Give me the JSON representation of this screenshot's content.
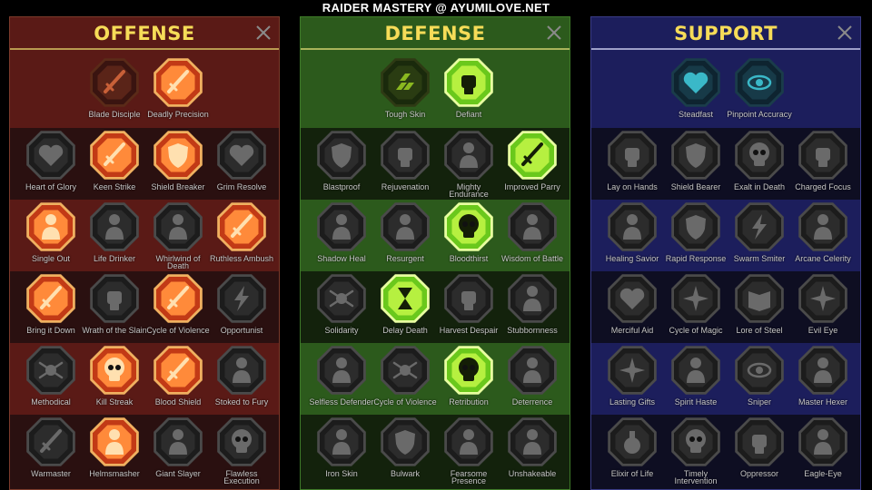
{
  "site": {
    "title": "RAIDER MASTERY @ AYUMILOVE.NET"
  },
  "panels": [
    {
      "key": "offense",
      "title": "OFFENSE",
      "colors": {
        "band_dark": "#2a1010",
        "band_light": "#5a1a16",
        "border": "#7a3a2a",
        "line": "#b89a50"
      },
      "tier1": [
        {
          "label": "Blade Disciple",
          "active": false,
          "icon": "crossed-swords-icon"
        },
        {
          "label": "Deadly Precision",
          "active": true,
          "icon": "sword-icon"
        }
      ],
      "rows": [
        [
          {
            "label": "Heart of Glory",
            "active": false,
            "icon": "horned-heart-icon"
          },
          {
            "label": "Keen Strike",
            "active": true,
            "icon": "slash-icon"
          },
          {
            "label": "Shield Breaker",
            "active": true,
            "icon": "broken-shield-icon"
          },
          {
            "label": "Grim Resolve",
            "active": false,
            "icon": "thorn-heart-icon"
          }
        ],
        [
          {
            "label": "Single Out",
            "active": true,
            "icon": "arrows-target-icon"
          },
          {
            "label": "Life Drinker",
            "active": false,
            "icon": "fanged-mouth-icon"
          },
          {
            "label": "Whirlwind of Death",
            "active": false,
            "icon": "whirlwind-icon"
          },
          {
            "label": "Ruthless Ambush",
            "active": true,
            "icon": "dagger-hand-icon"
          }
        ],
        [
          {
            "label": "Bring it Down",
            "active": true,
            "icon": "falling-sword-icon"
          },
          {
            "label": "Wrath of the Slain",
            "active": false,
            "icon": "fist-icon"
          },
          {
            "label": "Cycle of Violence",
            "active": true,
            "icon": "axe-icon"
          },
          {
            "label": "Opportunist",
            "active": false,
            "icon": "chain-lightning-icon"
          }
        ],
        [
          {
            "label": "Methodical",
            "active": false,
            "icon": "spider-icon"
          },
          {
            "label": "Kill Streak",
            "active": true,
            "icon": "skull-icon"
          },
          {
            "label": "Blood Shield",
            "active": true,
            "icon": "sword-shield-icon"
          },
          {
            "label": "Stoked to Fury",
            "active": false,
            "icon": "flexing-figure-icon"
          }
        ],
        [
          {
            "label": "Warmaster",
            "active": false,
            "icon": "falling-blade-icon"
          },
          {
            "label": "Helmsmasher",
            "active": true,
            "icon": "helmet-icon"
          },
          {
            "label": "Giant Slayer",
            "active": false,
            "icon": "giant-icon"
          },
          {
            "label": "Flawless Execution",
            "active": false,
            "icon": "skull-blade-icon"
          }
        ]
      ]
    },
    {
      "key": "defense",
      "title": "DEFENSE",
      "colors": {
        "band_dark": "#13220c",
        "band_light": "#2c5a1c",
        "border": "#3e7a28",
        "line": "#a8b45a"
      },
      "tier1": [
        {
          "label": "Tough Skin",
          "active": false,
          "icon": "scales-icon"
        },
        {
          "label": "Defiant",
          "active": true,
          "icon": "raised-fist-icon"
        }
      ],
      "rows": [
        [
          {
            "label": "Blastproof",
            "active": false,
            "icon": "shield-chevron-icon"
          },
          {
            "label": "Rejuvenation",
            "active": false,
            "icon": "healing-hand-icon"
          },
          {
            "label": "Mighty Endurance",
            "active": false,
            "icon": "muscle-torso-icon"
          },
          {
            "label": "Improved Parry",
            "active": true,
            "icon": "parry-blades-icon"
          }
        ],
        [
          {
            "label": "Shadow Heal",
            "active": false,
            "icon": "shadow-figure-icon"
          },
          {
            "label": "Resurgent",
            "active": false,
            "icon": "knight-icon"
          },
          {
            "label": "Bloodthirst",
            "active": true,
            "icon": "skull-heart-icon"
          },
          {
            "label": "Wisdom of Battle",
            "active": false,
            "icon": "hooded-head-icon"
          }
        ],
        [
          {
            "label": "Solidarity",
            "active": false,
            "icon": "crowd-icon"
          },
          {
            "label": "Delay Death",
            "active": true,
            "icon": "hourglass-icon"
          },
          {
            "label": "Harvest Despair",
            "active": false,
            "icon": "open-palm-icon"
          },
          {
            "label": "Stubbornness",
            "active": false,
            "icon": "bull-icon"
          }
        ],
        [
          {
            "label": "Selfless Defender",
            "active": false,
            "icon": "running-figure-icon"
          },
          {
            "label": "Cycle of Violence",
            "active": false,
            "icon": "drops-icon"
          },
          {
            "label": "Retribution",
            "active": true,
            "icon": "radiant-skull-icon"
          },
          {
            "label": "Deterrence",
            "active": false,
            "icon": "deflect-icon"
          }
        ],
        [
          {
            "label": "Iron Skin",
            "active": false,
            "icon": "demon-face-icon"
          },
          {
            "label": "Bulwark",
            "active": false,
            "icon": "layered-shield-icon"
          },
          {
            "label": "Fearsome Presence",
            "active": false,
            "icon": "screaming-face-icon"
          },
          {
            "label": "Unshakeable",
            "active": false,
            "icon": "strongman-icon"
          }
        ]
      ]
    },
    {
      "key": "support",
      "title": "SUPPORT",
      "colors": {
        "band_dark": "#0e0e22",
        "band_light": "#1c1e5c",
        "border": "#3a3c86",
        "line": "#9ea0c8"
      },
      "tier1": [
        {
          "label": "Steadfast",
          "active": false,
          "icon": "plus-heart-icon"
        },
        {
          "label": "Pinpoint Accuracy",
          "active": false,
          "icon": "bullseye-icon"
        }
      ],
      "rows": [
        [
          {
            "label": "Lay on Hands",
            "active": false,
            "icon": "praying-hands-icon"
          },
          {
            "label": "Shield Bearer",
            "active": false,
            "icon": "shield-icon"
          },
          {
            "label": "Exalt in Death",
            "active": false,
            "icon": "skull-smoke-icon"
          },
          {
            "label": "Charged Focus",
            "active": false,
            "icon": "bow-hand-icon"
          }
        ],
        [
          {
            "label": "Healing Savior",
            "active": false,
            "icon": "healer-figure-icon"
          },
          {
            "label": "Rapid Response",
            "active": false,
            "icon": "lightning-shield-icon"
          },
          {
            "label": "Swarm Smiter",
            "active": false,
            "icon": "twin-lightning-icon"
          },
          {
            "label": "Arcane Celerity",
            "active": false,
            "icon": "afterimage-figure-icon"
          }
        ],
        [
          {
            "label": "Merciful Aid",
            "active": false,
            "icon": "chained-heart-icon"
          },
          {
            "label": "Cycle of Magic",
            "active": false,
            "icon": "comet-icon"
          },
          {
            "label": "Lore of Steel",
            "active": false,
            "icon": "open-book-icon"
          },
          {
            "label": "Evil Eye",
            "active": false,
            "icon": "burst-icon"
          }
        ],
        [
          {
            "label": "Lasting Gifts",
            "active": false,
            "icon": "star-burst-icon"
          },
          {
            "label": "Spirit Haste",
            "active": false,
            "icon": "winged-boot-icon"
          },
          {
            "label": "Sniper",
            "active": false,
            "icon": "eye-icon"
          },
          {
            "label": "Master Hexer",
            "active": false,
            "icon": "hex-rune-icon"
          }
        ],
        [
          {
            "label": "Elixir of Life",
            "active": false,
            "icon": "flask-icon"
          },
          {
            "label": "Timely Intervention",
            "active": false,
            "icon": "hooded-skull-icon"
          },
          {
            "label": "Oppressor",
            "active": false,
            "icon": "gauntlet-icon"
          },
          {
            "label": "Eagle-Eye",
            "active": false,
            "icon": "eagle-icon"
          }
        ]
      ]
    }
  ]
}
